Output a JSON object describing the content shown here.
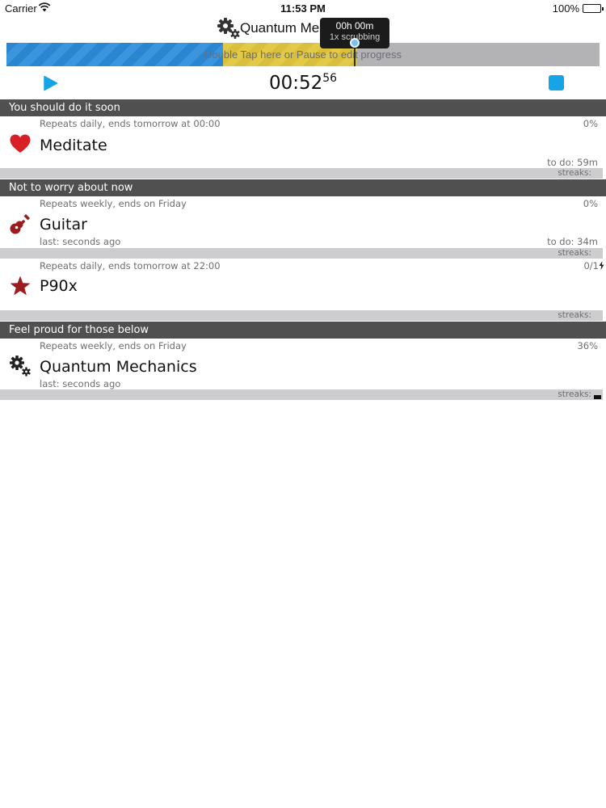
{
  "status_bar": {
    "carrier": "Carrier",
    "time": "11:53 PM",
    "battery_percent": "100%",
    "battery_level": 1.0
  },
  "header": {
    "title": "Quantum Mechanics",
    "icon": "gear-icon"
  },
  "progress": {
    "hint": "Double Tap here or Pause to edit progress",
    "colors": {
      "blue": "#2b86d1",
      "yellow": "#e2c947",
      "track": "#b3b3b5"
    }
  },
  "tooltip": {
    "line1": "00h 00m",
    "line2": "1x scrubbing"
  },
  "controls": {
    "timer_main": "00:52",
    "timer_sub": "56",
    "play_icon": "play-icon",
    "stop_icon": "stop-icon",
    "accent_color": "#16a4e6"
  },
  "sections": [
    {
      "title": "You should do it soon",
      "tasks": [
        {
          "repeats": "Repeats daily, ends tomorrow at 00:00",
          "percent": "0%",
          "icon": "heart-icon",
          "name": "Meditate",
          "last": "",
          "todo": "to do: 59m",
          "streaks": "streaks:"
        }
      ]
    },
    {
      "title": "Not to worry about now",
      "tasks": [
        {
          "repeats": "Repeats weekly, ends on Friday",
          "percent": "0%",
          "icon": "guitar-icon",
          "name": "Guitar",
          "last": "last: seconds ago",
          "todo": "to do: 34m",
          "streaks": "streaks:"
        },
        {
          "repeats": "Repeats daily, ends tomorrow at 22:00",
          "percent": "0/1",
          "icon": "star-icon",
          "name": "P90x",
          "last": "",
          "todo": "",
          "streaks": "streaks:"
        }
      ]
    },
    {
      "title": "Feel proud for those below",
      "tasks": [
        {
          "repeats": "Repeats weekly, ends on Friday",
          "percent": "36%",
          "icon": "gears-icon",
          "name": "Quantum Mechanics",
          "last": "last: seconds ago",
          "todo": "",
          "streaks": "streaks:"
        }
      ]
    }
  ]
}
